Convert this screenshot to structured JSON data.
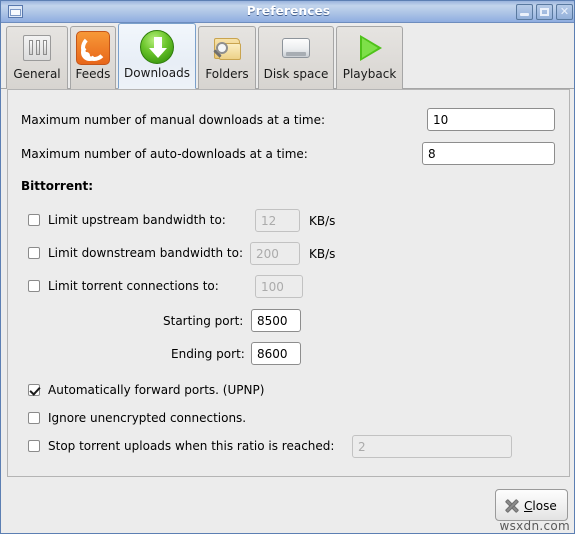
{
  "window": {
    "title": "Preferences",
    "menu_icon": "window-menu-icon",
    "minimize_icon": "minimize-icon",
    "maximize_icon": "maximize-icon",
    "close_icon": "close-icon",
    "title_bar_color": "#aec5e6",
    "background_color": "#ececec"
  },
  "tabs": [
    {
      "label": "General",
      "icon": "sliders-icon",
      "selected": false
    },
    {
      "label": "Feeds",
      "icon": "rss-feed-icon",
      "selected": false
    },
    {
      "label": "Downloads",
      "icon": "download-arrow-icon",
      "selected": true
    },
    {
      "label": "Folders",
      "icon": "folder-search-icon",
      "selected": false
    },
    {
      "label": "Disk space",
      "icon": "hard-disk-icon",
      "selected": false
    },
    {
      "label": "Playback",
      "icon": "play-triangle-icon",
      "selected": false
    }
  ],
  "downloads": {
    "max_manual": {
      "label": "Maximum number of manual downloads at a time:",
      "value": "10"
    },
    "max_auto": {
      "label": "Maximum number of auto-downloads at a time:",
      "value": "8"
    },
    "bittorrent_heading": "Bittorrent:",
    "limit_upstream": {
      "label": "Limit upstream bandwidth to:",
      "checked": false,
      "value": "12",
      "unit": "KB/s",
      "enabled": false
    },
    "limit_downstream": {
      "label": "Limit downstream bandwidth to:",
      "checked": false,
      "value": "200",
      "unit": "KB/s",
      "enabled": false
    },
    "limit_connections": {
      "label": "Limit torrent connections to:",
      "checked": false,
      "value": "100",
      "enabled": false
    },
    "starting_port": {
      "label": "Starting port:",
      "value": "8500"
    },
    "ending_port": {
      "label": "Ending port:",
      "value": "8600"
    },
    "upnp": {
      "label": "Automatically forward ports.  (UPNP)",
      "checked": true
    },
    "ignore_unencrypted": {
      "label": "Ignore unencrypted connections.",
      "checked": false
    },
    "stop_ratio": {
      "label": "Stop torrent uploads when this ratio is reached:",
      "checked": false,
      "value": "2",
      "enabled": false
    }
  },
  "actions": {
    "close": {
      "mnemonic": "C",
      "rest": "lose",
      "icon": "x-mark-icon"
    }
  },
  "watermark": "wsxdn.com"
}
